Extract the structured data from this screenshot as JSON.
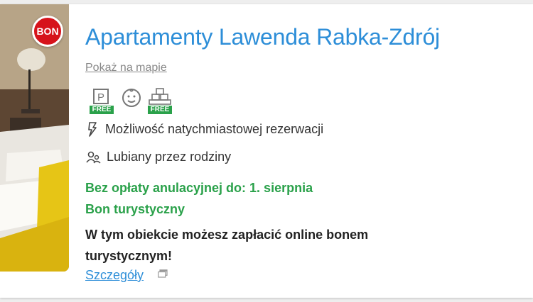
{
  "listing": {
    "badge": "BON",
    "title": "Apartamenty Lawenda Rabka-Zdrój",
    "map_link": "Pokaż na mapie",
    "amenities": [
      {
        "icon": "parking-icon",
        "tag": "FREE"
      },
      {
        "icon": "child-face-icon",
        "tag": ""
      },
      {
        "icon": "playground-icon",
        "tag": "FREE"
      }
    ],
    "instant_booking": "Możliwość natychmiastowej rezerwacji",
    "family_friendly": "Lubiany przez rodziny",
    "free_cancellation": "Bez opłaty anulacyjnej do: 1. sierpnia",
    "voucher_title": "Bon turystyczny",
    "voucher_desc": "W tym obiekcie możesz zapłacić online bonem turystycznym!",
    "details_link": "Szczegóły"
  },
  "colors": {
    "title": "#2d8ed8",
    "green": "#2aa14a",
    "badge": "#d6131b",
    "free_tag": "#2aa14a"
  }
}
